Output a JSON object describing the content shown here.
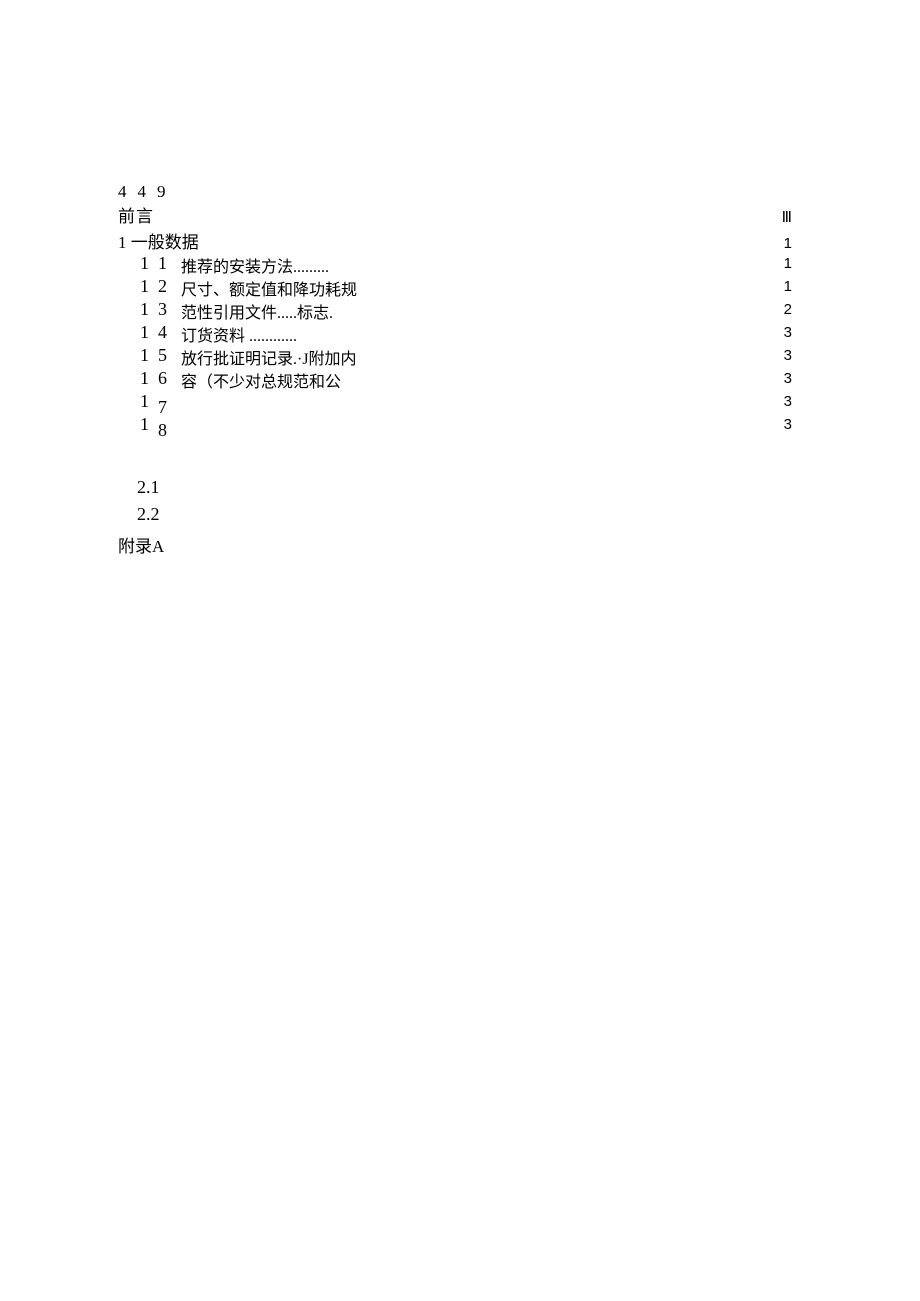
{
  "header_code": "449",
  "preface": {
    "label": "前言",
    "page": "Ⅲ"
  },
  "section1": {
    "label": "1 一般数据",
    "page": "1"
  },
  "toc": {
    "numbers": [
      {
        "a": "1",
        "b": "1",
        "drop": false
      },
      {
        "a": "1",
        "b": "2",
        "drop": false
      },
      {
        "a": "1",
        "b": "3",
        "drop": false
      },
      {
        "a": "1",
        "b": "4",
        "drop": false
      },
      {
        "a": "1",
        "b": "5",
        "drop": false
      },
      {
        "a": "1",
        "b": "6",
        "drop": false
      },
      {
        "a": "1",
        "b": "7",
        "drop": true
      },
      {
        "a": "1",
        "b": "8",
        "drop": true
      }
    ],
    "desc_lines": [
      "推荐的安装方法.........",
      "尺寸、额定值和降功耗规",
      "范性引用文件.....标志.",
      "订货资料 ............",
      "放行批证明记录.·J附加内",
      "容（不少对总规范和公"
    ],
    "pages": [
      "1",
      "1",
      "2",
      "3",
      "3",
      "3",
      "3",
      "3"
    ]
  },
  "lower": {
    "r21": "2.1",
    "r22": "2.2",
    "appendix": "附录A"
  }
}
